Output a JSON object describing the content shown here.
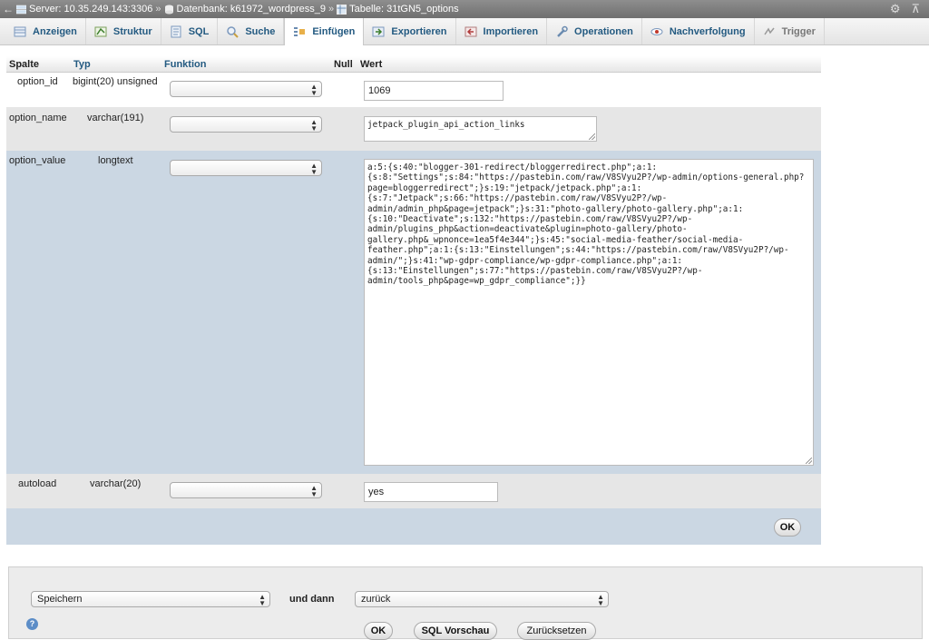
{
  "breadcrumb": {
    "server": "Server: 10.35.249.143:3306",
    "database": "Datenbank: k61972_wordpress_9",
    "table": "Tabelle: 31tGN5_options",
    "separator": "»"
  },
  "tabs": [
    {
      "label": "Anzeigen",
      "icon": "browse-icon"
    },
    {
      "label": "Struktur",
      "icon": "structure-icon"
    },
    {
      "label": "SQL",
      "icon": "sql-icon"
    },
    {
      "label": "Suche",
      "icon": "search-icon"
    },
    {
      "label": "Einfügen",
      "icon": "insert-icon"
    },
    {
      "label": "Exportieren",
      "icon": "export-icon"
    },
    {
      "label": "Importieren",
      "icon": "import-icon"
    },
    {
      "label": "Operationen",
      "icon": "wrench-icon"
    },
    {
      "label": "Nachverfolgung",
      "icon": "eye-icon"
    },
    {
      "label": "Trigger",
      "icon": "trigger-icon"
    }
  ],
  "active_tab": "Einfügen",
  "table_header": {
    "spalte": "Spalte",
    "typ": "Typ",
    "funktion": "Funktion",
    "null": "Null",
    "wert": "Wert"
  },
  "rows": [
    {
      "column": "option_id",
      "type": "bigint(20) unsigned",
      "function": "",
      "value": "1069"
    },
    {
      "column": "option_name",
      "type": "varchar(191)",
      "function": "",
      "value": "jetpack_plugin_api_action_links"
    },
    {
      "column": "option_value",
      "type": "longtext",
      "function": "",
      "value": "a:5:{s:40:\"blogger-301-redirect/bloggerredirect.php\";a:1:\n{s:8:\"Settings\";s:84:\"https://pastebin.com/raw/V8SVyu2P?/wp-admin/options-general.php?\npage=bloggerredirect\";}s:19:\"jetpack/jetpack.php\";a:1:\n{s:7:\"Jetpack\";s:66:\"https://pastebin.com/raw/V8SVyu2P?/wp-\nadmin/admin_php&page=jetpack\";}s:31:\"photo-gallery/photo-gallery.php\";a:1:\n{s:10:\"Deactivate\";s:132:\"https://pastebin.com/raw/V8SVyu2P?/wp-\nadmin/plugins_php&action=deactivate&plugin=photo-gallery/photo-\ngallery.php&_wpnonce=1ea5f4e344\";}s:45:\"social-media-feather/social-media-\nfeather.php\";a:1:{s:13:\"Einstellungen\";s:44:\"https://pastebin.com/raw/V8SVyu2P?/wp-\nadmin/\";}s:41:\"wp-gdpr-compliance/wp-gdpr-compliance.php\";a:1:\n{s:13:\"Einstellungen\";s:77:\"https://pastebin.com/raw/V8SVyu2P?/wp-\nadmin/tools_php&page=wp_gdpr_compliance\";}}"
    },
    {
      "column": "autoload",
      "type": "varchar(20)",
      "function": "",
      "value": "yes"
    }
  ],
  "ok_label": "OK",
  "footer": {
    "action_select": "Speichern",
    "und_dann": "und dann",
    "after_select": "zurück",
    "ok_label": "OK",
    "sql_preview_label": "SQL Vorschau",
    "reset_label": "Zurücksetzen"
  },
  "colors": {
    "link": "#235a81",
    "row_light": "#e6e6e6",
    "row_highlight": "#cbd7e3",
    "topbar": "#7a7a7a"
  }
}
